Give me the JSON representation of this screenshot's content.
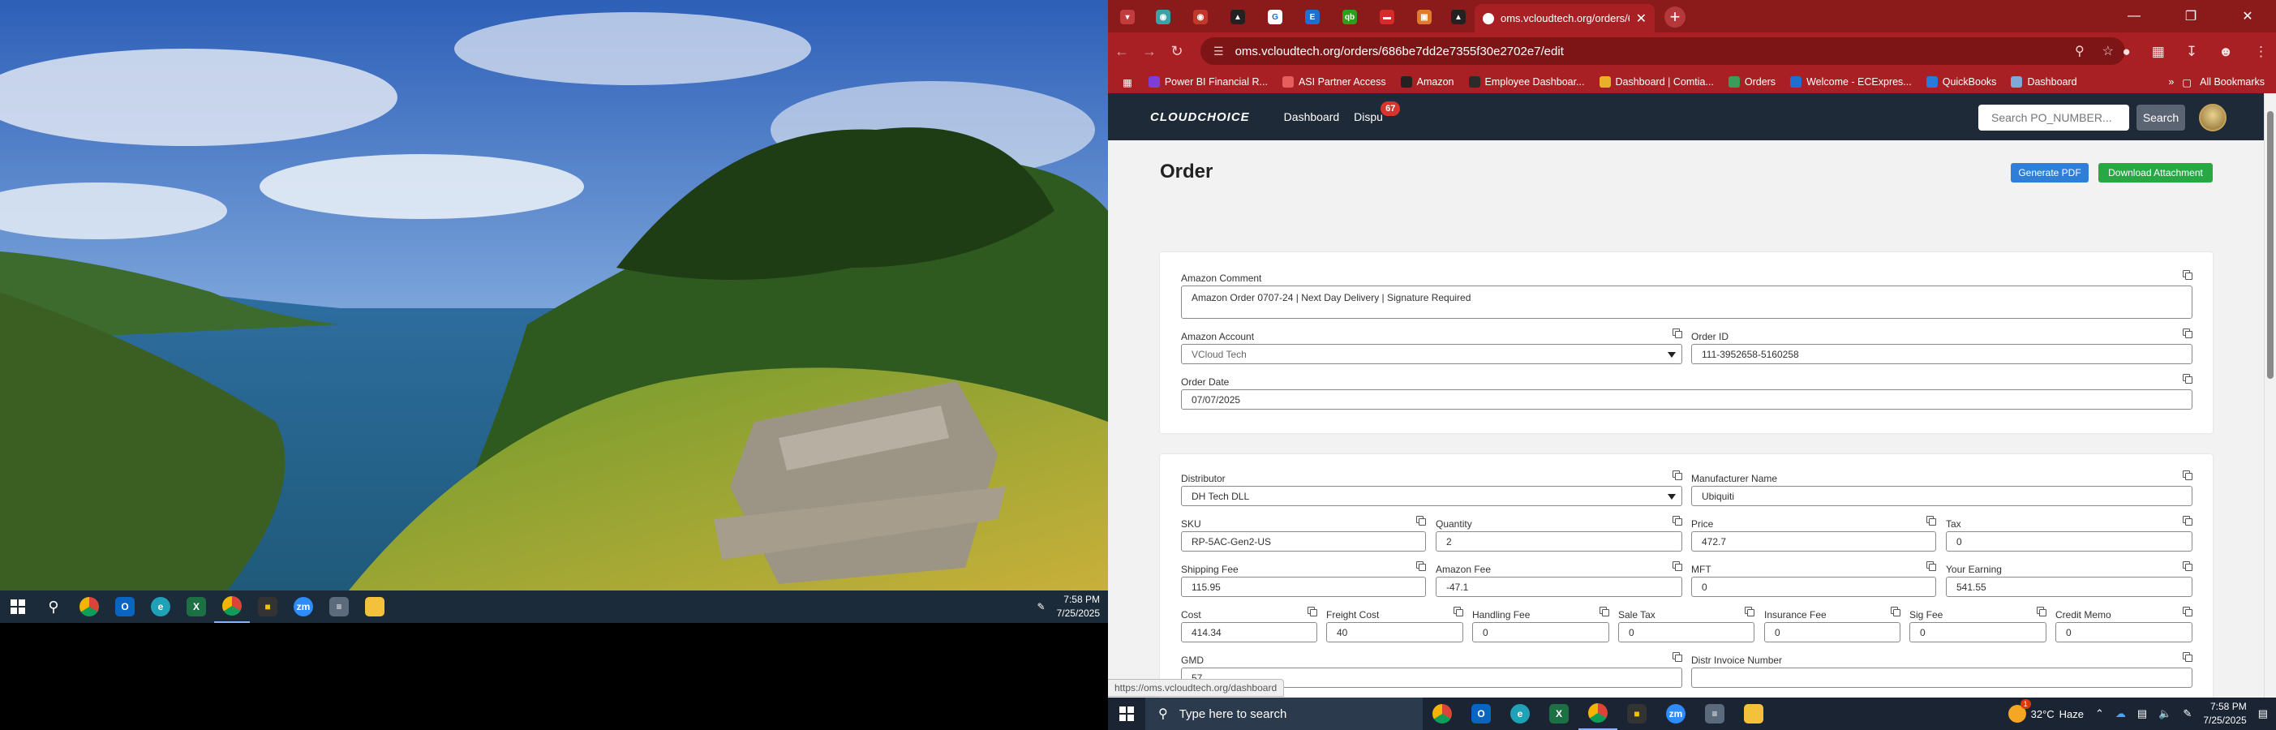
{
  "left_screen": {
    "clock": {
      "time": "7:58 PM",
      "date": "7/25/2025"
    }
  },
  "browser": {
    "active_tab": {
      "title": "oms.vcloudtech.org/orders/68"
    },
    "address": "oms.vcloudtech.org/orders/686be7dd2e7355f30e2702e7/edit",
    "bookmarks": [
      {
        "label": "Power BI Financial R...",
        "color": "#7b3fd6"
      },
      {
        "label": "ASI Partner Access",
        "color": "#e85d5d"
      },
      {
        "label": "Amazon",
        "color": "#222222"
      },
      {
        "label": "Employee Dashboar...",
        "color": "#2b2b2b"
      },
      {
        "label": "Dashboard | Comtia...",
        "color": "#e9b02a"
      },
      {
        "label": "Orders",
        "color": "#3c9d5a"
      },
      {
        "label": "Welcome - ECExpres...",
        "color": "#1f6fd1"
      },
      {
        "label": "QuickBooks",
        "color": "#2a7ad9"
      },
      {
        "label": "Dashboard",
        "color": "#7fa9d6"
      }
    ],
    "all_bookmarks": "All Bookmarks"
  },
  "app": {
    "logo": "CLOUDCHOICE",
    "nav": {
      "dashboard": "Dashboard",
      "disputes": "Dispu",
      "disputes_badge": "67"
    },
    "search": {
      "placeholder": "Search PO_NUMBER...",
      "button": "Search"
    },
    "page_title": "Order",
    "buttons": {
      "generate_pdf": "Generate PDF",
      "download_attachment": "Download Attachment"
    },
    "order_info": {
      "amazon_comment": {
        "label": "Amazon Comment",
        "value": "Amazon Order 0707-24 | Next Day Delivery | Signature Required"
      },
      "amazon_account": {
        "label": "Amazon Account",
        "value": "VCloud Tech"
      },
      "order_id": {
        "label": "Order ID",
        "value": "111-3952658-5160258"
      },
      "order_date": {
        "label": "Order Date",
        "value": "07/07/2025"
      }
    },
    "details": {
      "distributor": {
        "label": "Distributor",
        "value": "DH Tech DLL"
      },
      "manufacturer": {
        "label": "Manufacturer Name",
        "value": "Ubiquiti"
      },
      "sku": {
        "label": "SKU",
        "value": "RP-5AC-Gen2-US"
      },
      "quantity": {
        "label": "Quantity",
        "value": "2"
      },
      "price": {
        "label": "Price",
        "value": "472.7"
      },
      "tax": {
        "label": "Tax",
        "value": "0"
      },
      "shipping_fee": {
        "label": "Shipping Fee",
        "value": "115.95"
      },
      "amazon_fee": {
        "label": "Amazon Fee",
        "value": "-47.1"
      },
      "mft": {
        "label": "MFT",
        "value": "0"
      },
      "your_earning": {
        "label": "Your Earning",
        "value": "541.55"
      },
      "cost": {
        "label": "Cost",
        "value": "414.34"
      },
      "freight_cost": {
        "label": "Freight Cost",
        "value": "40"
      },
      "handling_fee": {
        "label": "Handling Fee",
        "value": "0"
      },
      "sale_tax": {
        "label": "Sale Tax",
        "value": "0"
      },
      "insurance_fee": {
        "label": "Insurance Fee",
        "value": "0"
      },
      "sig_fee": {
        "label": "Sig Fee",
        "value": "0"
      },
      "credit_memo": {
        "label": "Credit Memo",
        "value": "0"
      },
      "gmd": {
        "label": "GMD",
        "value": "57"
      },
      "distributor_invoice": {
        "label": "Distr Invoice Number",
        "value": ""
      }
    },
    "status_url": "https://oms.vcloudtech.org/dashboard"
  },
  "right_taskbar": {
    "search_placeholder": "Type here to search",
    "weather": {
      "temp": "32°C",
      "condition": "Haze",
      "badge": "1"
    },
    "clock": {
      "time": "7:58 PM",
      "date": "7/25/2025"
    }
  }
}
